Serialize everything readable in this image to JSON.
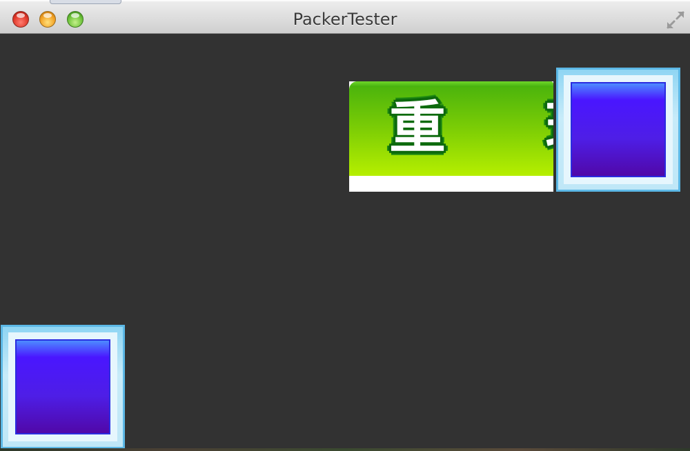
{
  "window": {
    "title": "PackerTester",
    "controls": {
      "close": "close-button",
      "minimize": "minimize-button",
      "zoom": "zoom-button",
      "fullscreen": "fullscreen-icon"
    }
  },
  "content": {
    "background_color": "#323232",
    "replay_button": {
      "label": "重 玩",
      "colors": {
        "top": "#46b10d",
        "bottom": "#b6ef00",
        "outline": "#0d6a0d"
      }
    },
    "tiles": [
      {
        "name": "blue-tile-top-right",
        "color": "#4a16ff",
        "frame": "#8fd5f3"
      },
      {
        "name": "blue-tile-bottom-left",
        "color": "#4a16ff",
        "frame": "#8fd5f3"
      }
    ]
  }
}
